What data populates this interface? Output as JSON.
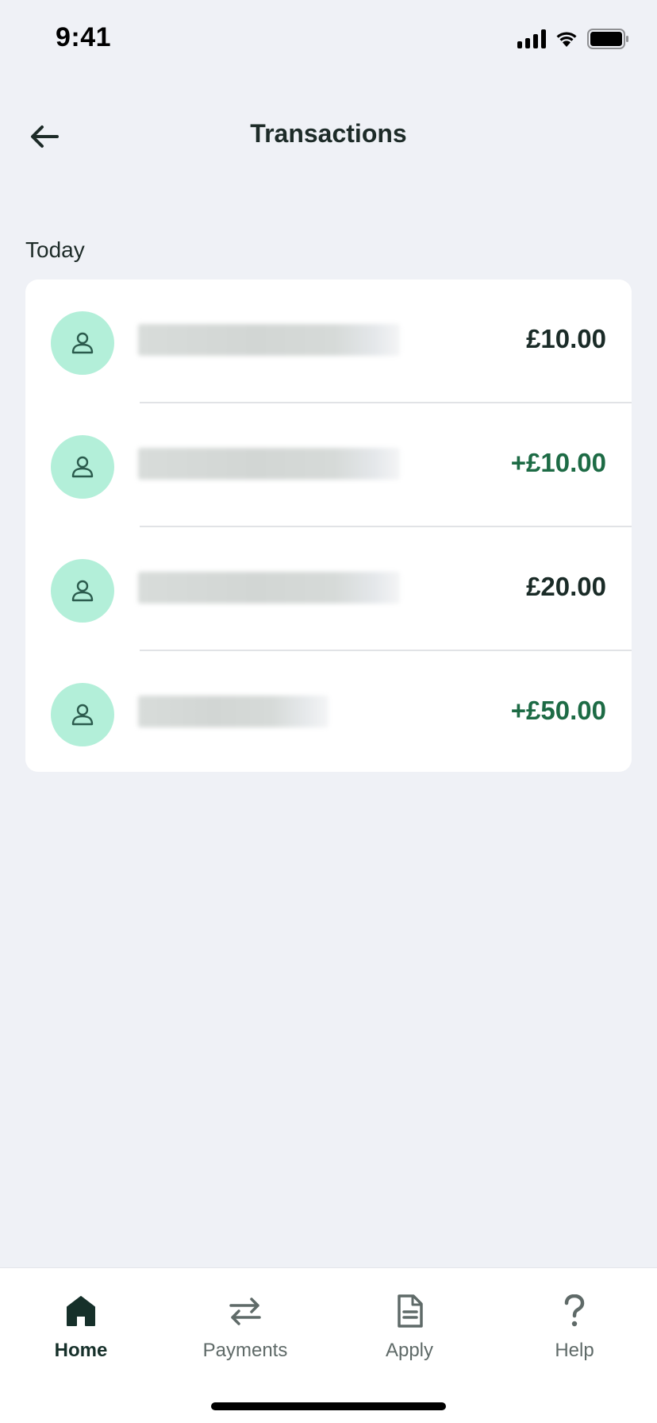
{
  "status_bar": {
    "time": "9:41"
  },
  "header": {
    "title": "Transactions"
  },
  "section": {
    "label": "Today"
  },
  "transactions": [
    {
      "amount": "£10.00",
      "type": "debit"
    },
    {
      "amount": "+£10.00",
      "type": "credit"
    },
    {
      "amount": "£20.00",
      "type": "debit"
    },
    {
      "amount": "+£50.00",
      "type": "credit"
    }
  ],
  "colors": {
    "debit": "#1a2b27",
    "credit": "#1d6b45",
    "avatar_bg": "#b3efd9",
    "avatar_icon": "#2b5b4d"
  },
  "bottom_nav": {
    "items": [
      {
        "label": "Home",
        "icon": "home-icon",
        "active": true
      },
      {
        "label": "Payments",
        "icon": "transfer-icon",
        "active": false
      },
      {
        "label": "Apply",
        "icon": "document-icon",
        "active": false
      },
      {
        "label": "Help",
        "icon": "help-icon",
        "active": false
      }
    ]
  }
}
